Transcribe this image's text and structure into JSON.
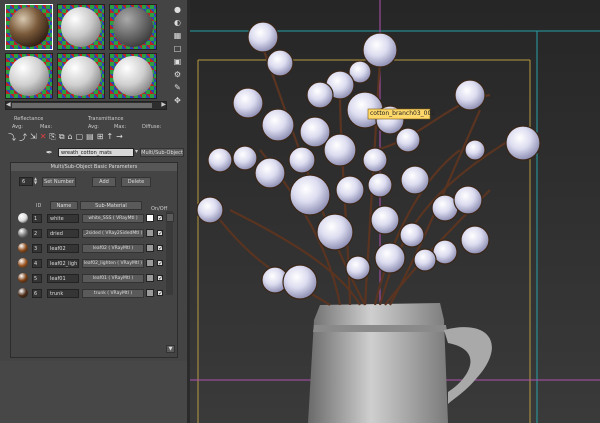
{
  "material_editor": {
    "toolbar_top": {
      "reflectance_label": "Reflectance",
      "reflectance_avg": "Avg:",
      "reflectance_max": "Max:",
      "transmittance_label": "Transmittance",
      "transmittance_avg": "Avg:",
      "transmittance_max": "Max:",
      "diffuse_label": "Diffuse:"
    },
    "material_name": "wreath_cotton_mats",
    "material_type": "Multi/Sub-Object",
    "rollout_title": "Multi/Sub-Object Basic Parameters",
    "count_value": "6",
    "set_number_label": "Set Number",
    "add_label": "Add",
    "delete_label": "Delete",
    "columns": {
      "id": "ID",
      "name": "Name",
      "sub_material": "Sub-Material",
      "on_off": "On/Off"
    },
    "rows": [
      {
        "id": "1",
        "name": "white",
        "sub_material": "white_SSS  ( VRayMtl )",
        "color": "#ffffff",
        "ball": "#dcdcdc",
        "on": true
      },
      {
        "id": "2",
        "name": "dried",
        "sub_material": "_2sided  ( VRay2SidedMtl )",
        "color": "#9a9a9a",
        "ball": "#7a7a7a",
        "on": true
      },
      {
        "id": "3",
        "name": "leaf02",
        "sub_material": "leaf02  ( VRayMtl )",
        "color": "#9a9a9a",
        "ball": "#8a4a1a",
        "on": true
      },
      {
        "id": "4",
        "name": "leaf02_ligh",
        "sub_material": "leaf02_lighten  ( VRayMtl )",
        "color": "#9a9a9a",
        "ball": "#9a5420",
        "on": true
      },
      {
        "id": "5",
        "name": "leaf01",
        "sub_material": "leaf01  ( VRayMtl )",
        "color": "#9a9a9a",
        "ball": "#7a3e14",
        "on": true
      },
      {
        "id": "6",
        "name": "trunk",
        "sub_material": "trunk  ( VRayMtl )",
        "color": "#9a9a9a",
        "ball": "#4a2a16",
        "on": true
      }
    ],
    "accent_color": "#ffd86a"
  },
  "viewport": {
    "tooltip": "cotton_branch03_001"
  }
}
